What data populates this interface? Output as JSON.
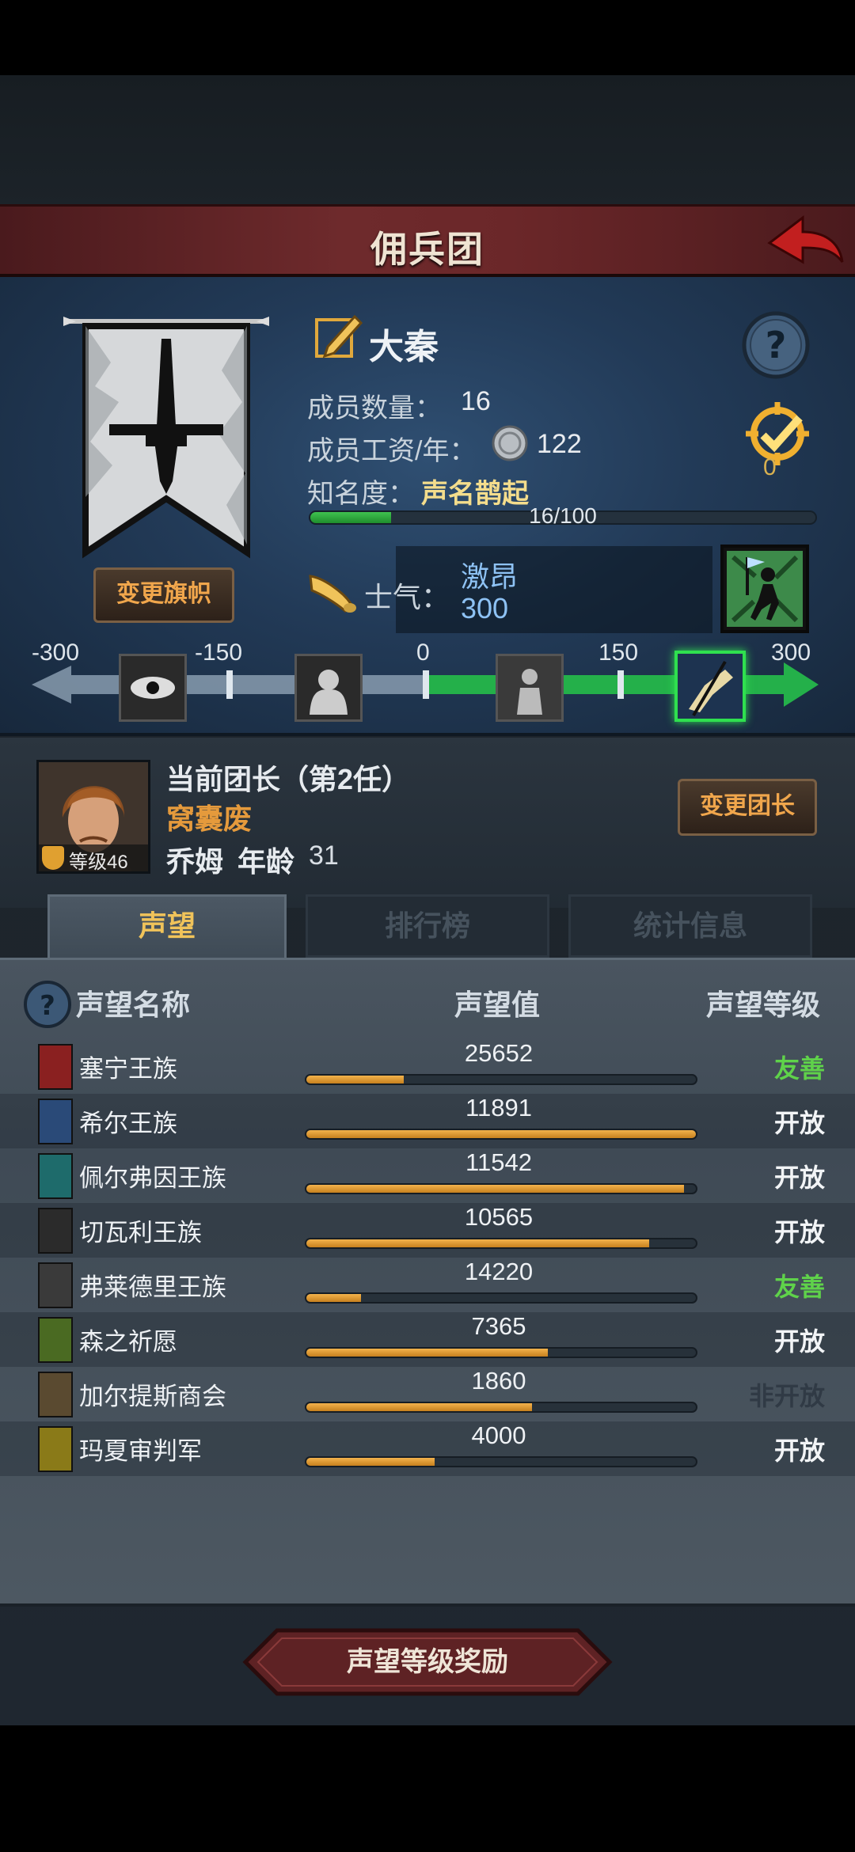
{
  "header": {
    "title": "佣兵团"
  },
  "company": {
    "name": "大秦",
    "members_label": "成员数量：",
    "members_value": "16",
    "salary_label": "成员工资/年：",
    "salary_value": "122",
    "fame_label": "知名度：",
    "fame_value": "声名鹊起",
    "fame_progress_text": "16/100",
    "fame_progress": 0.16,
    "change_banner_label": "变更旗帜",
    "achievement_count": "0"
  },
  "morale": {
    "label": "士气：",
    "state": "激昂",
    "value": "300",
    "ticks": [
      "-300",
      "-150",
      "0",
      "150",
      "300"
    ],
    "current": 300
  },
  "leader": {
    "title": "当前团长（第2任）",
    "trait": "窝囊废",
    "level_text": "等级46",
    "name": "乔姆",
    "age_label": "年龄",
    "age_value": "31",
    "change_leader_label": "变更团长"
  },
  "tabs": [
    {
      "label": "声望",
      "active": true
    },
    {
      "label": "排行榜",
      "active": false
    },
    {
      "label": "统计信息",
      "active": false
    }
  ],
  "reputation": {
    "headers": {
      "name": "声望名称",
      "value": "声望值",
      "level": "声望等级"
    },
    "rows": [
      {
        "name": "塞宁王族",
        "value": "25652",
        "fill": 0.25,
        "status": "友善",
        "status_type": "green",
        "icon": "red-crest-icon",
        "color": "#8a2020"
      },
      {
        "name": "希尔王族",
        "value": "11891",
        "fill": 1.0,
        "status": "开放",
        "status_type": "white",
        "icon": "blue-helm-icon",
        "color": "#2a4a78"
      },
      {
        "name": "佩尔弗因王族",
        "value": "11542",
        "fill": 0.97,
        "status": "开放",
        "status_type": "white",
        "icon": "teal-wave-icon",
        "color": "#1e6b6b"
      },
      {
        "name": "切瓦利王族",
        "value": "10565",
        "fill": 0.88,
        "status": "开放",
        "status_type": "white",
        "icon": "scales-icon",
        "color": "#2b2b2b"
      },
      {
        "name": "弗莱德里王族",
        "value": "14220",
        "fill": 0.14,
        "status": "友善",
        "status_type": "green",
        "icon": "dark-face-icon",
        "color": "#3a3a3a"
      },
      {
        "name": "森之祈愿",
        "value": "7365",
        "fill": 0.62,
        "status": "开放",
        "status_type": "white",
        "icon": "tree-icon",
        "color": "#4a6a22"
      },
      {
        "name": "加尔提斯商会",
        "value": "1860",
        "fill": 0.58,
        "status": "非开放",
        "status_type": "gray",
        "icon": "chest-icon",
        "color": "#5a4a30"
      },
      {
        "name": "玛夏审判军",
        "value": "4000",
        "fill": 0.33,
        "status": "开放",
        "status_type": "white",
        "icon": "gold-cross-icon",
        "color": "#8a7a18"
      }
    ]
  },
  "reward_button": {
    "label": "声望等级奖励"
  }
}
